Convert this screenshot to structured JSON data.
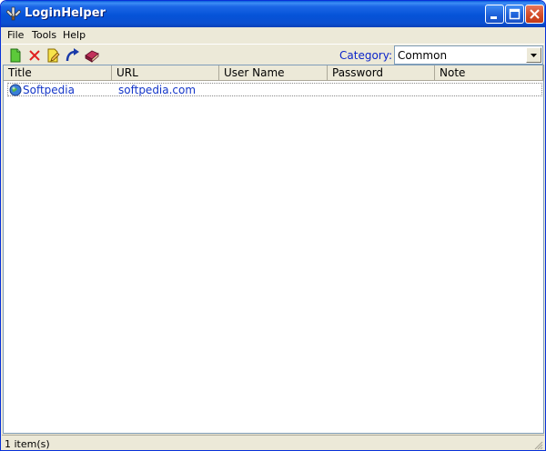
{
  "window": {
    "title": "LoginHelper"
  },
  "menu": {
    "items": [
      "File",
      "Tools",
      "Help"
    ]
  },
  "toolbar": {
    "icons": [
      "new-entry-icon",
      "delete-icon",
      "edit-icon",
      "open-url-icon",
      "address-book-icon"
    ],
    "category_label": "Category:",
    "category_value": "Common"
  },
  "list": {
    "columns": [
      "Title",
      "URL",
      "User Name",
      "Password",
      "Note"
    ],
    "rows": [
      {
        "title": "Softpedia",
        "url": "softpedia.com",
        "user": "",
        "password": "",
        "note": ""
      }
    ]
  },
  "status": {
    "text": "1 item(s)"
  },
  "colors": {
    "title_bar": "#0553d8",
    "accent_text": "#1436c8",
    "category_label": "#0b24c9"
  }
}
